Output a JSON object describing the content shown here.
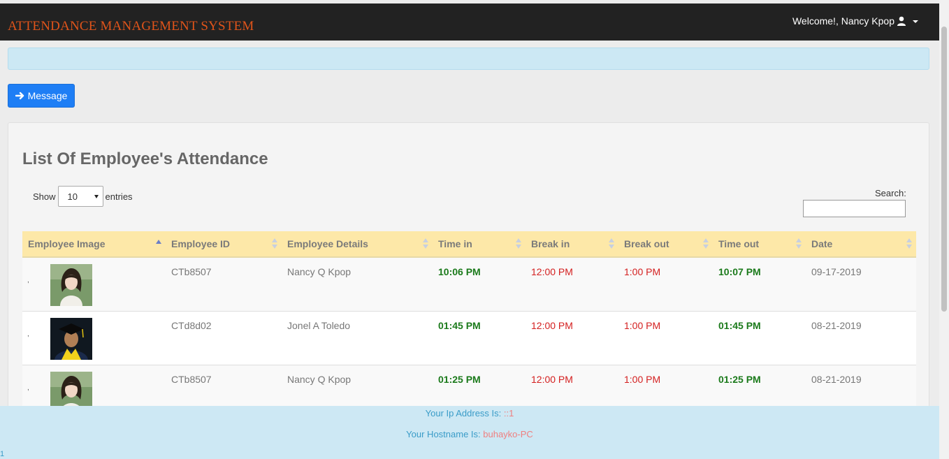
{
  "header": {
    "brand": "ATTENDANCE MANAGEMENT SYSTEM",
    "welcome": "Welcome!, Nancy Kpop"
  },
  "actions": {
    "message_label": "Message"
  },
  "panel": {
    "title": "List Of Employee's Attendance",
    "show_label": "Show",
    "entries_value": "10",
    "entries_label": "entries",
    "search_label": "Search:",
    "search_value": ""
  },
  "table": {
    "columns": [
      "Employee Image",
      "Employee ID",
      "Employee Details",
      "Time in",
      "Break in",
      "Break out",
      "Time out",
      "Date"
    ],
    "rows": [
      {
        "marker": ",",
        "photo": "female-portrait",
        "id": "CTb8507",
        "details": "Nancy Q Kpop",
        "time_in": "10:06 PM",
        "break_in": "12:00 PM",
        "break_out": "1:00 PM",
        "time_out": "10:07 PM",
        "date": "09-17-2019"
      },
      {
        "marker": ",",
        "photo": "graduate-portrait",
        "id": "CTd8d02",
        "details": "Jonel A Toledo",
        "time_in": "01:45 PM",
        "break_in": "12:00 PM",
        "break_out": "1:00 PM",
        "time_out": "01:45 PM",
        "date": "08-21-2019"
      },
      {
        "marker": ",",
        "photo": "female-portrait",
        "id": "CTb8507",
        "details": "Nancy Q Kpop",
        "time_in": "01:25 PM",
        "break_in": "12:00 PM",
        "break_out": "1:00 PM",
        "time_out": "01:25 PM",
        "date": "08-21-2019"
      }
    ]
  },
  "footer": {
    "ip_label": "Your Ip Address Is:",
    "ip_value": "::1",
    "host_label": "Your Hostname Is:",
    "host_value": "buhayko-PC",
    "counter": "1"
  },
  "colors": {
    "brand": "#e0541a",
    "time_ok": "#1b7a1b",
    "break": "#d42020",
    "header_bg": "#fde8a8",
    "button": "#1e7ef5"
  }
}
